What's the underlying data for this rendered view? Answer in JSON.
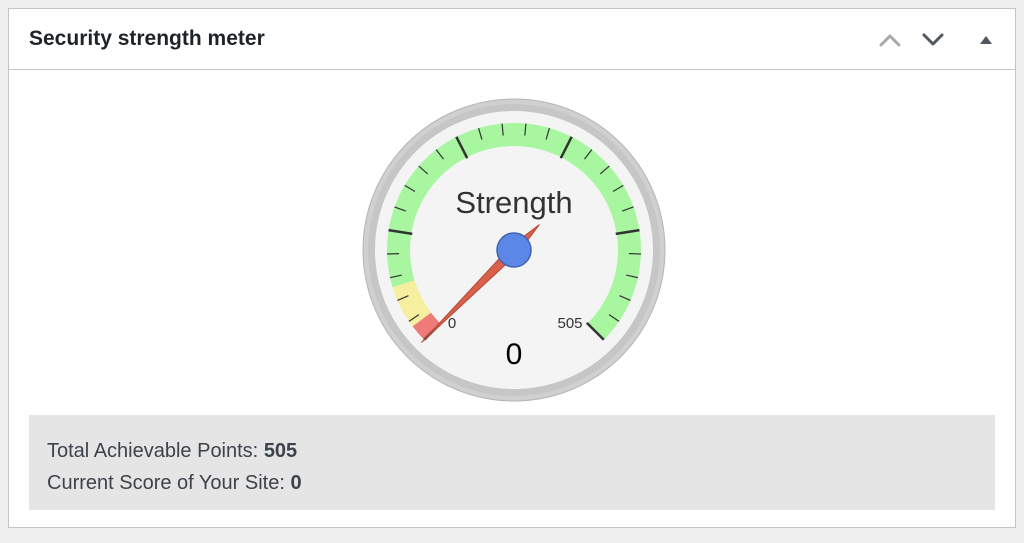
{
  "widget": {
    "title": "Security strength meter",
    "icons": {
      "move_up": "chevron-up-icon",
      "move_down": "chevron-down-icon",
      "toggle": "caret-up-icon"
    }
  },
  "gauge": {
    "title": "Strength",
    "min": 0,
    "max": 505,
    "min_label": "0",
    "max_label": "505",
    "value": 0,
    "value_label": "0",
    "colors": {
      "green_band": "#a8f7a0",
      "yellow_band": "#f5ef9f",
      "red_band": "#ef7a7a",
      "needle": "#d9604a",
      "hub": "#5b87e6"
    }
  },
  "summary": {
    "total_label": "Total Achievable Points:",
    "total_value": "505",
    "current_label": "Current Score of Your Site:",
    "current_value": "0"
  }
}
